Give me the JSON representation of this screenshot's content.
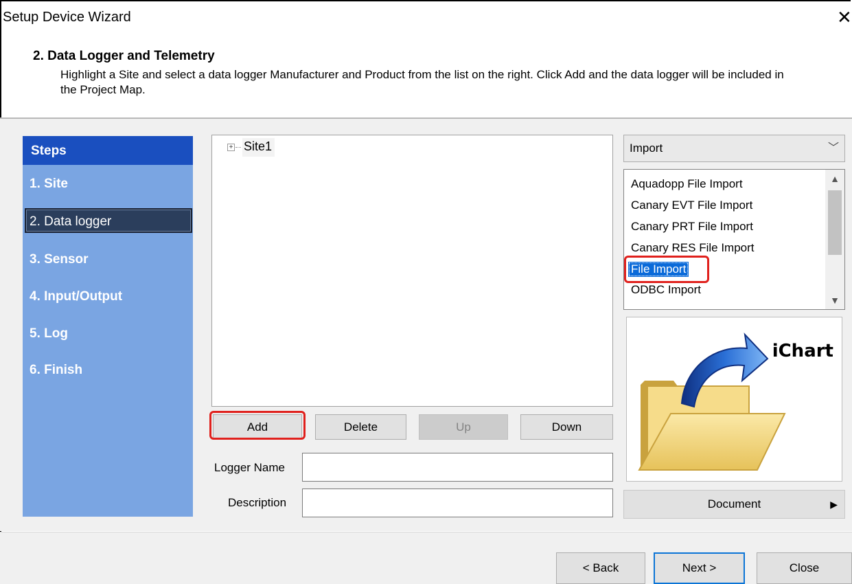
{
  "window": {
    "title": "Setup Device Wizard",
    "close_glyph": "✕"
  },
  "header": {
    "title": "2. Data Logger and Telemetry",
    "description": "Highlight a Site and select a data logger Manufacturer and Product from the list on the right. Click Add and the data logger will be included in the Project Map."
  },
  "steps": {
    "heading": "Steps",
    "items": [
      {
        "label": "1. Site"
      },
      {
        "label": "2. Data logger",
        "active": true
      },
      {
        "label": "3. Sensor"
      },
      {
        "label": "4. Input/Output"
      },
      {
        "label": "5. Log"
      },
      {
        "label": "6. Finish"
      }
    ]
  },
  "tree": {
    "expander": "+",
    "root_label": "Site1"
  },
  "buttons": {
    "add": "Add",
    "delete": "Delete",
    "up": "Up",
    "down": "Down"
  },
  "fields": {
    "logger_name_label": "Logger Name",
    "logger_name_value": "",
    "description_label": "Description",
    "description_value": ""
  },
  "manufacturer_combo": {
    "selected": "Import",
    "chevron": "﹀"
  },
  "product_list": {
    "items": [
      "Aquadopp File Import",
      "Canary EVT File Import",
      "Canary PRT File Import",
      "Canary RES File Import",
      "File Import",
      "ODBC Import"
    ],
    "selected": "File Import",
    "scroll_up": "▲",
    "scroll_down": "▼"
  },
  "preview": {
    "label": "iChart"
  },
  "document_button": {
    "label": "Document",
    "arrow": "▶"
  },
  "footer": {
    "back": "< Back",
    "next": "Next >",
    "close": "Close"
  },
  "colors": {
    "steps_bg": "#7aa5e2",
    "steps_header": "#1a4fbf",
    "selection": "#0a6ad9",
    "highlight_ring": "#e0201c"
  }
}
